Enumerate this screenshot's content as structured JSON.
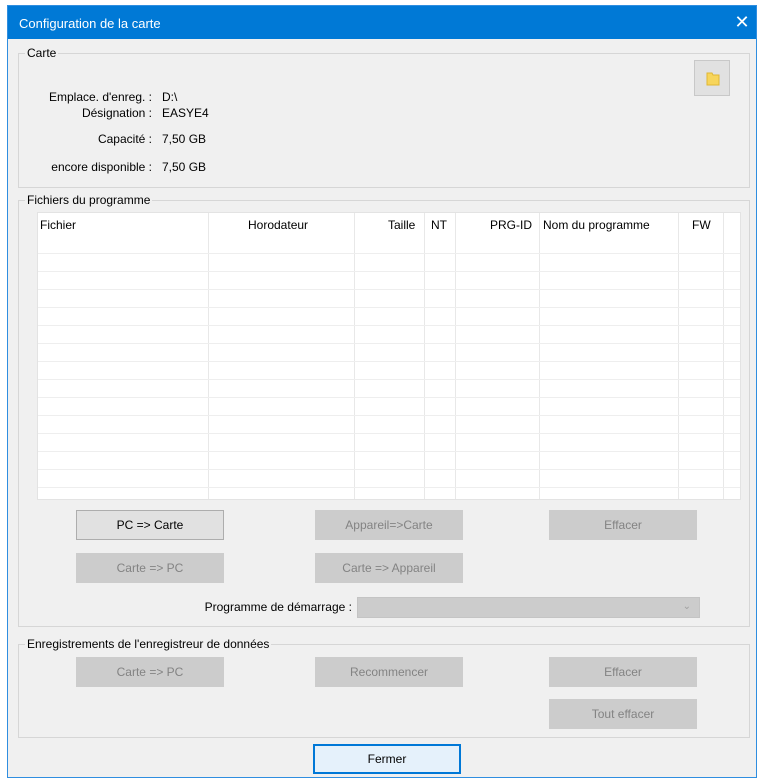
{
  "window": {
    "title": "Configuration de la carte",
    "close_glyph": "✕"
  },
  "carte": {
    "group_label": "Carte",
    "rows": [
      {
        "label": "Emplace. d'enreg. :",
        "value": "D:\\"
      },
      {
        "label": "Désignation :",
        "value": "EASYE4"
      },
      {
        "label": "Capacité :",
        "value": "7,50 GB"
      },
      {
        "label": "encore disponible :",
        "value": "7,50 GB"
      }
    ],
    "browse_icon": "folder-icon",
    "browse_icon_color": "#f7d55b"
  },
  "program_files": {
    "group_label": "Fichiers du programme",
    "columns": [
      "Fichier",
      "Horodateur",
      "Taille",
      "NT",
      "PRG-ID",
      "Nom du programme",
      "FW"
    ],
    "rows": [],
    "buttons": {
      "pc_to_card": "PC => Carte",
      "device_to_card": "Appareil=>Carte",
      "delete": "Effacer",
      "card_to_pc": "Carte => PC",
      "card_to_device": "Carte => Appareil"
    },
    "startup_label": "Programme de démarrage :",
    "startup_value": ""
  },
  "datalogger": {
    "group_label": "Enregistrements de l'enregistreur de données",
    "buttons": {
      "card_to_pc": "Carte => PC",
      "restart": "Recommencer",
      "delete": "Effacer",
      "delete_all": "Tout effacer"
    }
  },
  "footer": {
    "close_label": "Fermer"
  },
  "colors": {
    "titlebar": "#0079d6",
    "primary_border": "#0078d7",
    "disabled_bg": "#cccccc"
  }
}
